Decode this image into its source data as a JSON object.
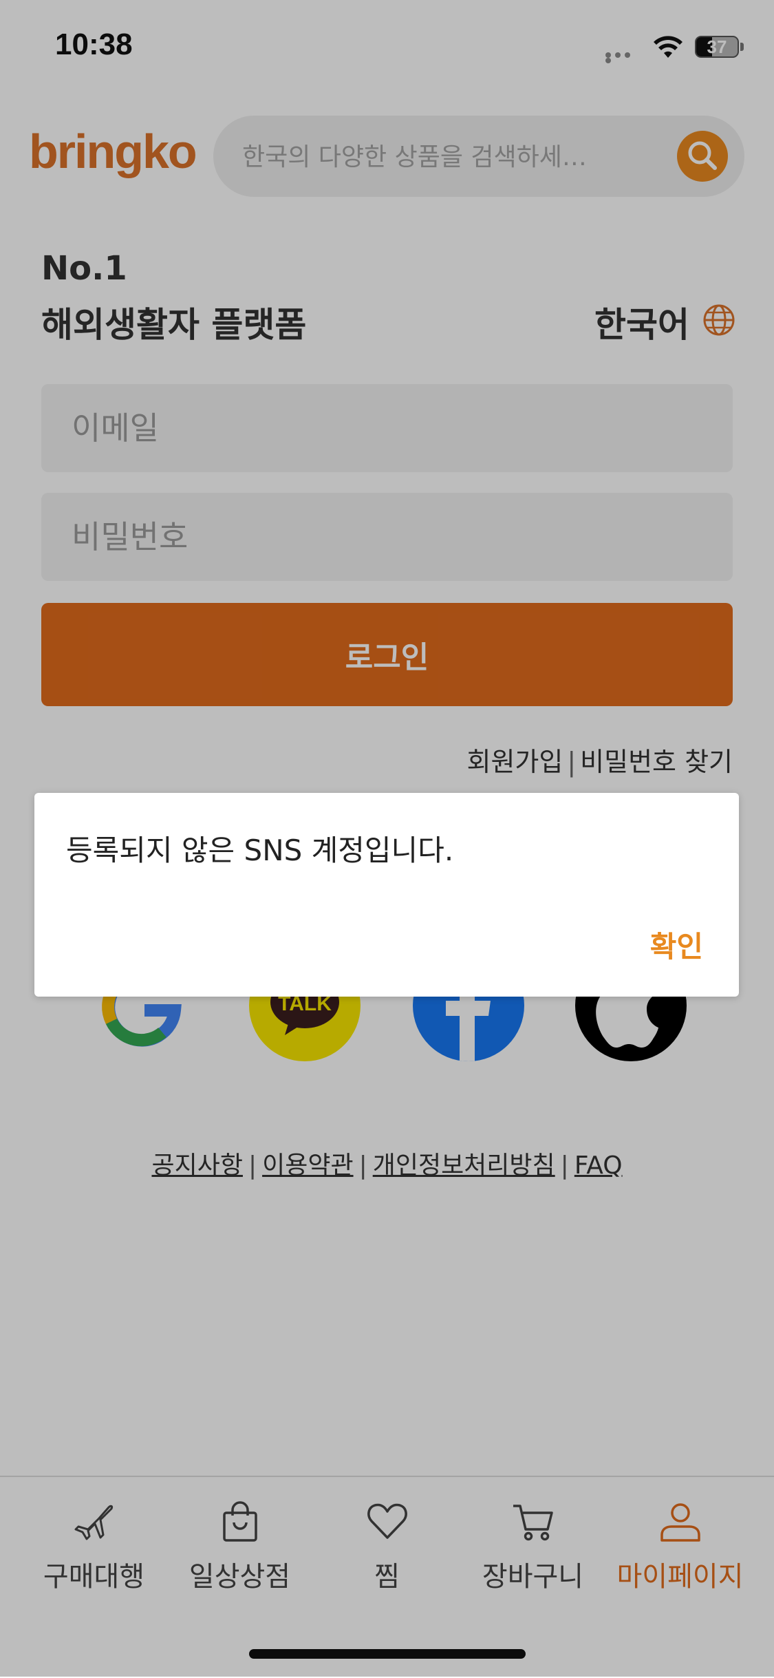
{
  "status_bar": {
    "time": "10:38",
    "battery": "37"
  },
  "header": {
    "logo": "bringko",
    "search_placeholder": "한국의 다양한 상품을 검색하세…"
  },
  "headline": {
    "line1": "No.1",
    "line2": "해외생활자 플랫폼",
    "language": "한국어"
  },
  "login_form": {
    "email_placeholder": "이메일",
    "password_placeholder": "비밀번호",
    "login_label": "로그인"
  },
  "aux_links": {
    "signup": "회원가입",
    "separator": "|",
    "find_password": "비밀번호 찾기"
  },
  "social_buttons": [
    "google-icon",
    "kakaotalk-icon",
    "facebook-icon",
    "apple-icon"
  ],
  "social_text": {
    "kakao": "TALK"
  },
  "footer_links": {
    "notice": "공지사항",
    "terms": "이용약관",
    "privacy": "개인정보처리방침",
    "faq": "FAQ",
    "separator": "|"
  },
  "tabbar": {
    "items": [
      {
        "label": "구매대행",
        "icon": "airplane-icon"
      },
      {
        "label": "일상상점",
        "icon": "shopping-bag-icon"
      },
      {
        "label": "찜",
        "icon": "heart-icon"
      },
      {
        "label": "장바구니",
        "icon": "cart-icon"
      },
      {
        "label": "마이페이지",
        "icon": "person-icon"
      }
    ],
    "active_index": 4
  },
  "dialog": {
    "message": "등록되지 않은 SNS 계정입니다.",
    "confirm_label": "확인"
  },
  "colors": {
    "brand_orange": "#e06b1c",
    "accent_orange": "#e8891f",
    "logo_orange": "#d9722a"
  }
}
